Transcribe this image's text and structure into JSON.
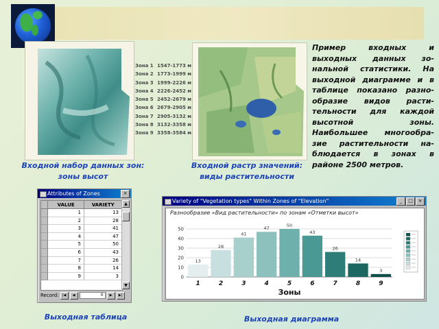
{
  "legend": [
    {
      "zone": "Зона 1",
      "range": "1547-1773 м"
    },
    {
      "zone": "Зона 2",
      "range": "1773-1999 м"
    },
    {
      "zone": "Зона 3",
      "range": "1999-2226 м"
    },
    {
      "zone": "Зона 4",
      "range": "2226-2452 м"
    },
    {
      "zone": "Зона 5",
      "range": "2452-2679 м"
    },
    {
      "zone": "Зона 6",
      "range": "2679-2905 м"
    },
    {
      "zone": "Зона 7",
      "range": "2905-3132 м"
    },
    {
      "zone": "Зона 8",
      "range": "3132-3358 м"
    },
    {
      "zone": "Зона 9",
      "range": "3358-3584 м"
    }
  ],
  "captions": {
    "input_zones_line1": "Входной набор данных зон:",
    "input_zones_line2": "зоны высот",
    "input_raster_line1": "Входной растр значений:",
    "input_raster_line2": "виды растительности",
    "output_table": "Выходная таблица",
    "output_chart": "Выходная диаграмма"
  },
  "description": "Пример входных и выходных данных зо-нальной статистики. На выходной диаграмме и в таблице показано разно-образие видов расти-тельности для каждой высотной зоны. Наибольшее многообра-зие растительности на-блюдается в зонах в районе 2500 метров.",
  "table_window": {
    "title": "Attributes of Zones",
    "columns": [
      "VALUE",
      "VARIETY"
    ],
    "rows": [
      {
        "value": "1",
        "variety": "13"
      },
      {
        "value": "2",
        "variety": "28"
      },
      {
        "value": "3",
        "variety": "41"
      },
      {
        "value": "4",
        "variety": "47"
      },
      {
        "value": "5",
        "variety": "50"
      },
      {
        "value": "6",
        "variety": "43"
      },
      {
        "value": "7",
        "variety": "26"
      },
      {
        "value": "8",
        "variety": "14"
      },
      {
        "value": "9",
        "variety": "3"
      }
    ],
    "record_label": "Record:",
    "record_value": "0"
  },
  "chart_window": {
    "title": "Variety of \"Vegetation types\" Within Zones of \"Elevation\""
  },
  "chart_data": {
    "type": "bar",
    "title": "Разнообразие «Вид растительности» по зонам «Отметки высот»",
    "xlabel": "Зоны",
    "ylabel": "",
    "categories": [
      "1",
      "2",
      "3",
      "4",
      "5",
      "6",
      "7",
      "8",
      "9"
    ],
    "values": [
      13,
      28,
      41,
      47,
      50,
      43,
      26,
      14,
      3
    ],
    "ylim": [
      0,
      50
    ],
    "yticks": [
      0,
      10,
      20,
      30,
      40,
      50
    ],
    "grid": true,
    "colors": [
      "#e4eeee",
      "#c7e0df",
      "#a7d0cd",
      "#8dc1be",
      "#6db0ac",
      "#4b9995",
      "#2f7d78",
      "#1c6762",
      "#0e4f4a"
    ]
  }
}
